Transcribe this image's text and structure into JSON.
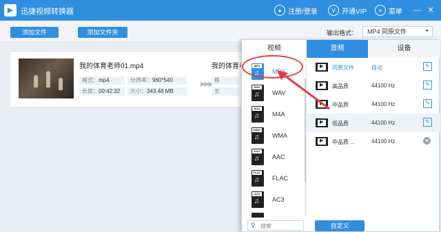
{
  "app": {
    "title": "迅捷视频转换器",
    "logo_icon": "film-logo-icon"
  },
  "titlebar": {
    "login_label": "注册/登录",
    "vip_label": "开通VIP",
    "menu_label": "菜单",
    "minimize": "—",
    "close": "✕"
  },
  "toolbar": {
    "add_file": "添加文件",
    "add_folder": "添加文件夹",
    "output_format_label": "输出格式：",
    "output_format_value": "MP4  同原文件"
  },
  "file": {
    "name": "我的体育老师01.mp4",
    "format_key": "格式：",
    "format_val": "mp4",
    "resolution_key": "分辨率：",
    "resolution_val": "960*540",
    "duration_key": "长度：",
    "duration_val": "00:42:32",
    "size_key": "大小：",
    "size_val": "343.48 MB",
    "output_name": "我的体育老",
    "out_format_key": "格",
    "out_duration_key": "长"
  },
  "panel": {
    "tabs": [
      "视频",
      "音频",
      "设备"
    ],
    "active_tab": "音频",
    "formats": [
      {
        "tag": "MP3",
        "label": "MP3",
        "selected": true
      },
      {
        "tag": "WAV",
        "label": "WAV"
      },
      {
        "tag": "M4A",
        "label": "M4A"
      },
      {
        "tag": "WMA",
        "label": "WMA"
      },
      {
        "tag": "AAC",
        "label": "AAC"
      },
      {
        "tag": "FLAC",
        "label": "FLAC"
      },
      {
        "tag": "AC3",
        "label": "AC3"
      }
    ],
    "qualities": [
      {
        "name": "同原文件",
        "value": "自动",
        "action": "edit",
        "custom": true
      },
      {
        "name": "高品质",
        "value": "44100 Hz",
        "action": "edit"
      },
      {
        "name": "中品质",
        "value": "44100 Hz",
        "action": "edit"
      },
      {
        "name": "低品质",
        "value": "44100 Hz",
        "action": "edit"
      },
      {
        "name": "中品质 ...",
        "value": "44100 Hz",
        "action": "delete"
      }
    ],
    "search_placeholder": "搜索",
    "custom_button": "自定义"
  },
  "colors": {
    "accent": "#2f8ee0",
    "highlight": "#e0403c"
  }
}
